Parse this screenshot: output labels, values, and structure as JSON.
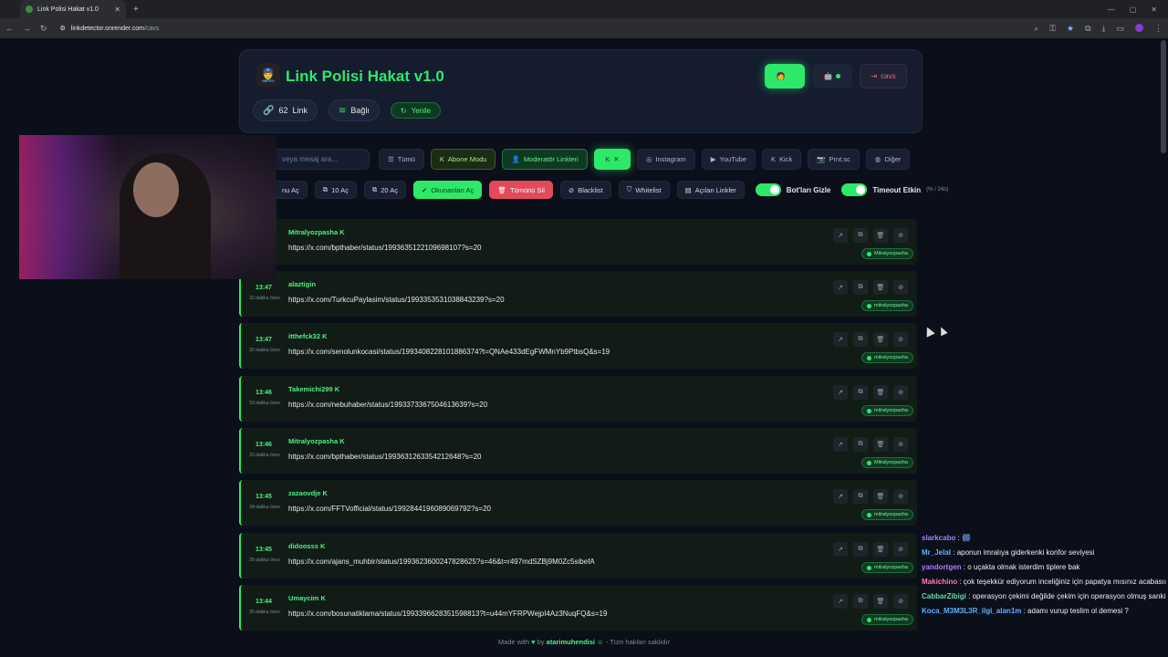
{
  "browser": {
    "tab_title": "Link Polisi Hakat v1.0",
    "url_host": "linkdetector.onrender.com",
    "url_path": "/cavs"
  },
  "header": {
    "title": "Link Polisi Hakat v1.0",
    "link_count": "62",
    "link_label": "Link",
    "status": "Bağlı",
    "refresh": "Yenile",
    "logout": "cavs"
  },
  "search": {
    "placeholder": "veya mesaj ara..."
  },
  "filters": [
    "Tümü",
    "Abone Modu",
    "Moderatör Linkleri",
    "K",
    "Instagram",
    "YouTube",
    "Kick",
    "Prnt.sc",
    "Diğer"
  ],
  "actions": {
    "open_all": "nu Aç",
    "open_10": "10 Aç",
    "open_20": "20 Aç",
    "open_unread": "Okunanları Aç",
    "delete_all": "Tümünü Sil",
    "blacklist": "Blacklist",
    "whitelist": "Whitelist",
    "opened_links": "Açılan Linkler",
    "hide_bots": "Bot'ları Gizle",
    "timeout": "Timeout Etkin",
    "timeout_sub": "(% / 24s)"
  },
  "rows": [
    {
      "time": "",
      "ago": "",
      "user": "Mitralyozpasha",
      "link": "https://x.com/bpthaber/status/1993635122109698107?s=20",
      "badge": "Mitralyozpasha"
    },
    {
      "time": "13:47",
      "ago": "32 dakika önce",
      "user": "alaztigin",
      "link": "https://x.com/TurkcuPaylasim/status/1993353531038843239?s=20",
      "badge": "mitralyozpasha"
    },
    {
      "time": "13:47",
      "ago": "32 dakika önce",
      "user": "itthefck32",
      "link": "https://x.com/senolunkocasi/status/1993408228101886374?t=QNAe433dEgFWMnYb9PtbsQ&s=19",
      "badge": "mitralyozpasha"
    },
    {
      "time": "13:46",
      "ago": "33 dakika önce",
      "user": "Takemichi299",
      "link": "https://x.com/nebuhaber/status/1993373367504613639?s=20",
      "badge": "mitralyozpasha"
    },
    {
      "time": "13:46",
      "ago": "33 dakika önce",
      "user": "Mitralyozpasha",
      "link": "https://x.com/bpthaber/status/1993631263354212648?s=20",
      "badge": "Mitralyozpasha"
    },
    {
      "time": "13:45",
      "ago": "34 dakika önce",
      "user": "zazaovdje",
      "link": "https://x.com/FFTVofficial/status/1992844196089069792?s=20",
      "badge": "mitralyozpasha"
    },
    {
      "time": "13:45",
      "ago": "35 dakika önce",
      "user": "didoosss",
      "link": "https://x.com/ajans_muhbir/status/1993623600247828625?s=46&t=r497mdSZBj9M0Zc5sibefA",
      "badge": "mitralyozpasha"
    },
    {
      "time": "13:44",
      "ago": "35 dakika önce",
      "user": "Umaycim",
      "link": "https://x.com/bosunatiklama/status/1993396628351598813?t=u44mYFRPWejpI4Az3NuqFQ&s=19",
      "badge": "mitralyozpasha"
    }
  ],
  "footer": {
    "made_with": "Made with",
    "by": "by",
    "author": "atarimuhendisi",
    "rights": "- Tüm hakları saklıdır"
  },
  "chat": [
    {
      "name": "slarkcabo",
      "msg": ": 🎆"
    },
    {
      "name": "Mr_Jelal",
      "msg": ": aponun imralıya giderkenki konfor seviyesi"
    },
    {
      "name": "yandortgen",
      "msg": ": o uçakta olmak isterdim tiplere bak"
    },
    {
      "name": "Makichino",
      "msg": ": çok teşekkür ediyorum inceliğiniz için papatya mısınız acabasıı"
    },
    {
      "name": "CabbarZibigi",
      "msg": ": operasyon çekimi değilde çekim için operasyon olmuş sanki"
    },
    {
      "name": "Koca_M3M3L3R_ilgi_alan1m",
      "msg": ": adamı vurup teslim ol demesi ?"
    }
  ]
}
